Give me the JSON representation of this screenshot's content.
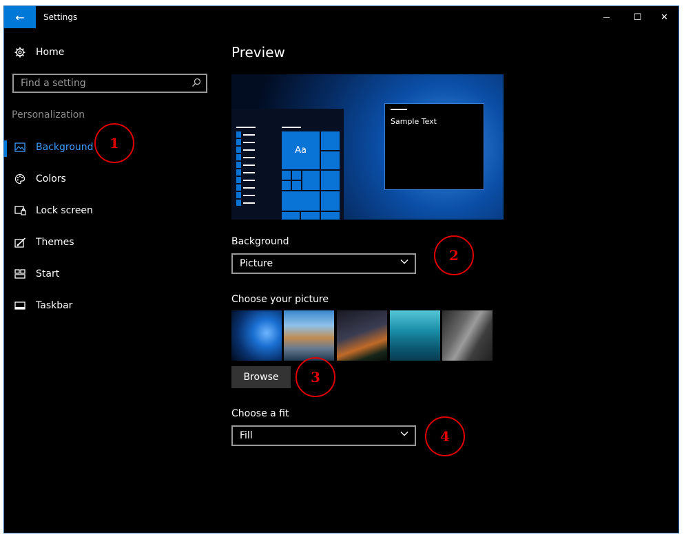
{
  "window": {
    "title": "Settings",
    "back_icon": "←",
    "minimize_icon": "—",
    "maximize_icon": "☐",
    "close_icon": "✕"
  },
  "sidebar": {
    "home_label": "Home",
    "search_placeholder": "Find a setting",
    "section_label": "Personalization",
    "items": [
      {
        "label": "Background",
        "icon": "picture-icon",
        "active": true
      },
      {
        "label": "Colors",
        "icon": "palette-icon"
      },
      {
        "label": "Lock screen",
        "icon": "lock-screen-icon"
      },
      {
        "label": "Themes",
        "icon": "themes-icon"
      },
      {
        "label": "Start",
        "icon": "start-icon"
      },
      {
        "label": "Taskbar",
        "icon": "taskbar-icon"
      }
    ]
  },
  "main": {
    "preview_heading": "Preview",
    "preview_tile_text": "Aa",
    "preview_sample_text": "Sample Text",
    "background_label": "Background",
    "background_value": "Picture",
    "choose_picture_label": "Choose your picture",
    "browse_label": "Browse",
    "choose_fit_label": "Choose a fit",
    "fit_value": "Fill"
  },
  "annotations": [
    "1",
    "2",
    "3",
    "4"
  ],
  "colors": {
    "accent": "#0078d7",
    "annotation": "#e00000",
    "background": "#000000"
  }
}
